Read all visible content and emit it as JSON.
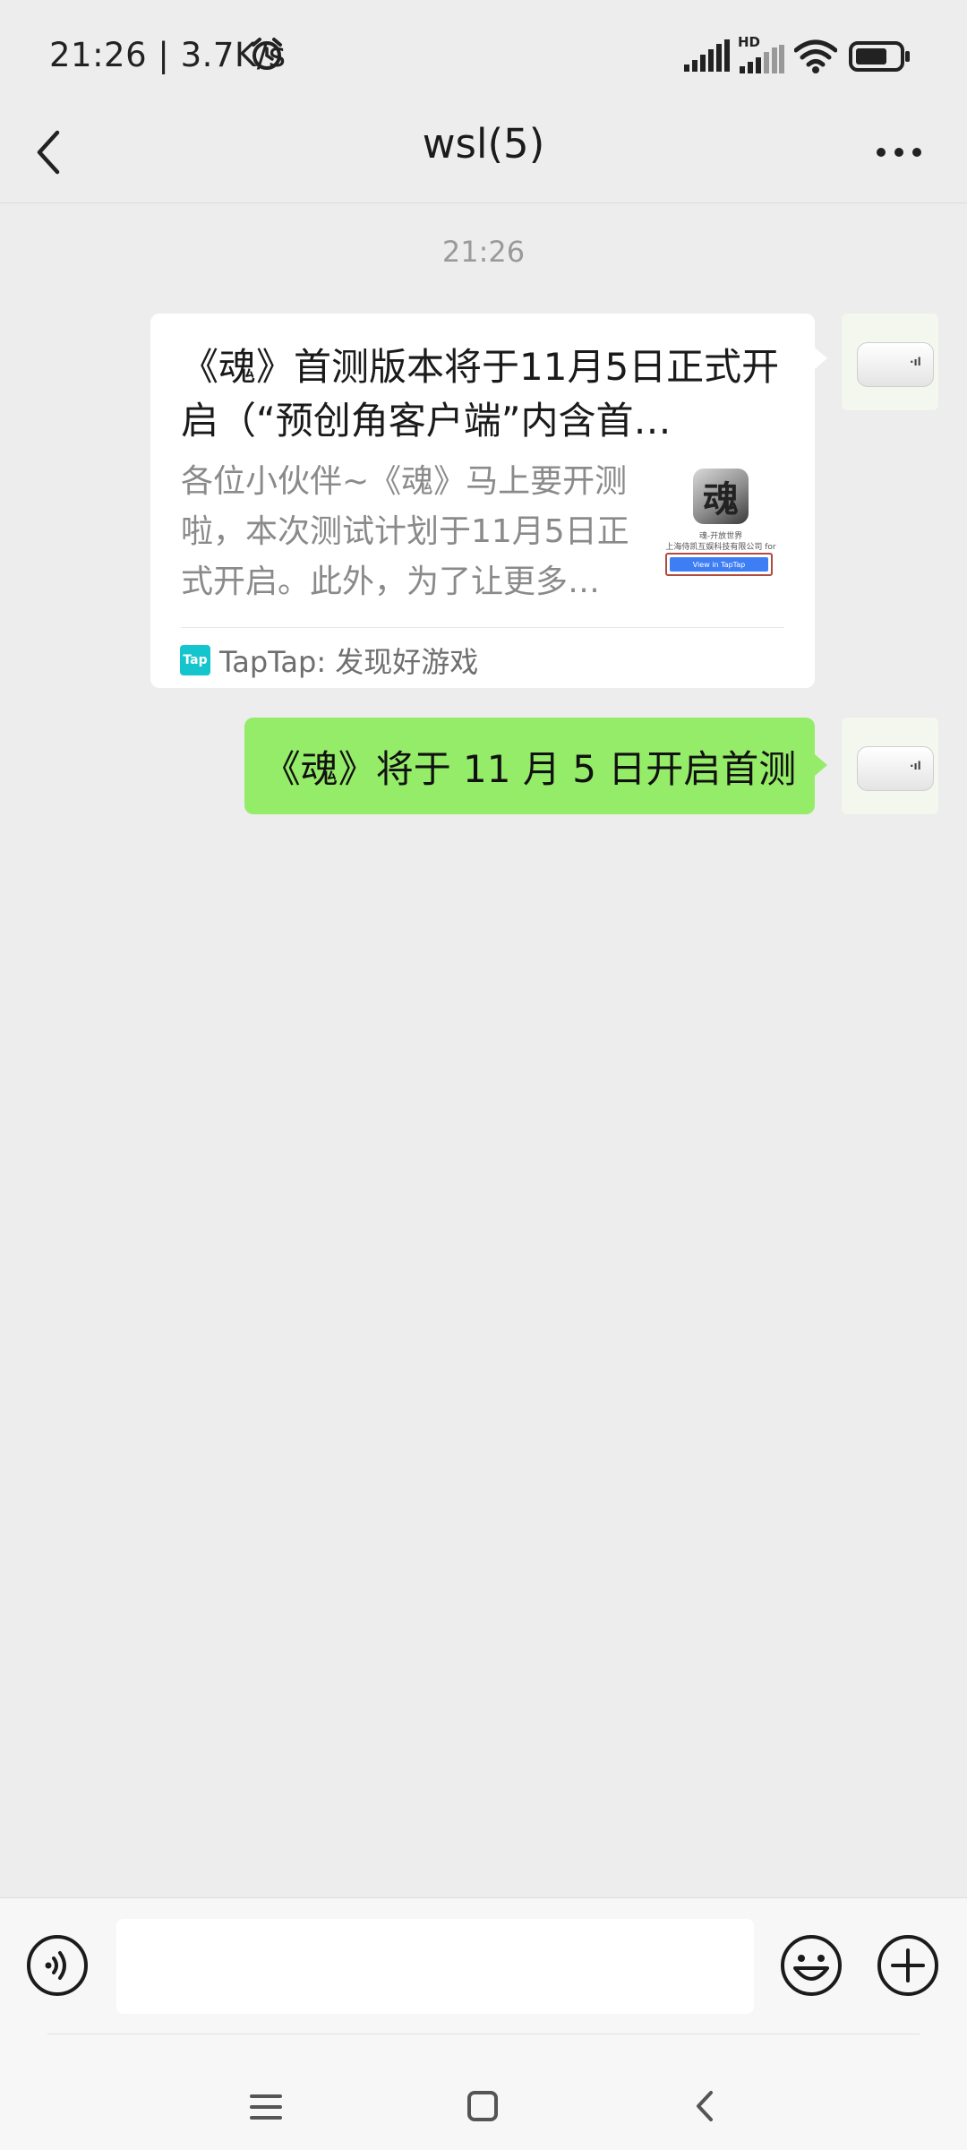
{
  "status_bar": {
    "time_speed": "21:26 | 3.7K/s",
    "network_badge": "HD",
    "icons": [
      "alarm-icon",
      "signal-icon",
      "hd-signal-icon",
      "wifi-icon",
      "battery-icon"
    ]
  },
  "header": {
    "title": "wsl(5)",
    "back_icon": "chevron-left-icon",
    "more_icon": "more-dots-icon"
  },
  "chat": {
    "timestamp": "21:26",
    "messages": [
      {
        "type": "link_card",
        "title": "《魂》首测版本将于11月5日正式开启（“预创角客户端”内含首…",
        "description": "各位小伙伴~《魂》马上要开测啦，本次测试计划于11月5日正式开启。此外，为了让更多…",
        "thumbnail": {
          "game_icon_char": "魂",
          "game_name": "魂-开放世界",
          "developer": "上海侍凯互娱科技有限公司 for",
          "button_label": "View in TapTap"
        },
        "source_icon_text": "Tap",
        "source": "TapTap: 发现好游戏"
      },
      {
        "type": "text",
        "text": "《魂》将于 11 月 5 日开启首测"
      }
    ]
  },
  "input_bar": {
    "message_value": "",
    "voice_icon": "voice-icon",
    "emoji_icon": "emoji-icon",
    "plus_icon": "plus-icon"
  },
  "nav_bar": {
    "icons": [
      "menu-icon",
      "home-icon",
      "back-icon"
    ]
  },
  "colors": {
    "background": "#ededed",
    "bubble_green": "#95ec69",
    "card_white": "#ffffff",
    "taptap_teal": "#15c5ce"
  }
}
